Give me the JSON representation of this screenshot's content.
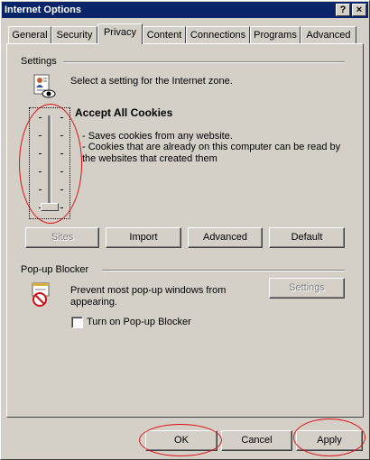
{
  "window": {
    "title": "Internet Options",
    "help_label": "?",
    "close_label": "×"
  },
  "tabs": [
    {
      "label": "General"
    },
    {
      "label": "Security"
    },
    {
      "label": "Privacy",
      "selected": true
    },
    {
      "label": "Content"
    },
    {
      "label": "Connections"
    },
    {
      "label": "Programs"
    },
    {
      "label": "Advanced"
    }
  ],
  "settings": {
    "group_label": "Settings",
    "zone_text": "Select a setting for the Internet zone.",
    "level_title": "Accept All Cookies",
    "desc_line1": "- Saves cookies from any website.",
    "desc_line2": "- Cookies that are already on this computer can be read by",
    "desc_line3": "the websites that created them",
    "slider_level": 0,
    "buttons": {
      "sites": "Sites",
      "import": "Import",
      "advanced": "Advanced",
      "default": "Default"
    }
  },
  "popup": {
    "group_label": "Pop-up Blocker",
    "desc_line1": "Prevent most pop-up windows from",
    "desc_line2": "appearing.",
    "settings_button": "Settings",
    "checkbox_label": "Turn on Pop-up Blocker",
    "checkbox_checked": false
  },
  "footer": {
    "ok": "OK",
    "cancel": "Cancel",
    "apply": "Apply"
  },
  "colors": {
    "titlebar": "#0a246a",
    "face": "#d4d0c8",
    "annotation": "#e01010"
  }
}
